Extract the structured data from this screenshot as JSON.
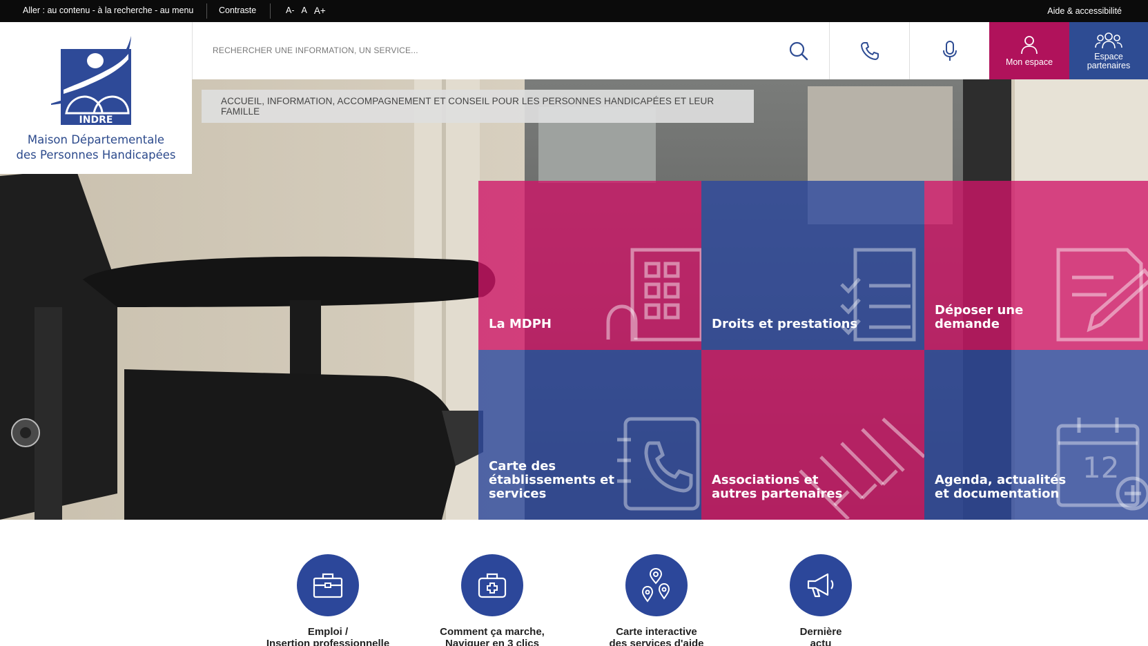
{
  "topbar": {
    "skip_prefix": "Aller : ",
    "skip_content": "au contenu",
    "skip_sep1": " - ",
    "skip_search": "à la recherche",
    "skip_sep2": " - ",
    "skip_menu": "au menu",
    "contrast": "Contraste",
    "font_smaller": "A-",
    "font_normal": "A",
    "font_larger": "A+",
    "help": "Aide & accessibilité"
  },
  "logo": {
    "badge_text": "INDRE",
    "line1": "Maison Départementale",
    "line2": "des Personnes Handicapées"
  },
  "search": {
    "placeholder": "RECHERCHER UNE INFORMATION, UN SERVICE..."
  },
  "header_buttons": {
    "espace": "Mon espace",
    "partners_line1": "Espace",
    "partners_line2": "partenaires"
  },
  "hero": {
    "tagline": "ACCUEIL, INFORMATION, ACCOMPAGNEMENT ET CONSEIL POUR LES PERSONNES HANDICAPÉES ET LEUR FAMILLE"
  },
  "tiles": [
    {
      "label": "La MDPH",
      "icon": "building-icon"
    },
    {
      "label": "Droits et prestations",
      "icon": "checklist-icon"
    },
    {
      "label": "Déposer une demande",
      "icon": "document-pen-icon"
    },
    {
      "label": "Carte des établissements et services",
      "icon": "phone-book-icon"
    },
    {
      "label": "Associations et autres partenaires",
      "icon": "handshake-icon"
    },
    {
      "label": "Agenda, actualités et documentation",
      "icon": "calendar-icon"
    }
  ],
  "quicklinks": [
    {
      "line1": "Emploi /",
      "line2": "Insertion professionnelle",
      "icon": "briefcase-icon"
    },
    {
      "line1": "Comment ça marche,",
      "line2": "Naviguer en 3 clics",
      "icon": "first-aid-kit-icon"
    },
    {
      "line1": "Carte interactive",
      "line2": "des services d'aide",
      "icon": "map-pins-icon"
    },
    {
      "line1": "Dernière",
      "line2": "actu",
      "icon": "megaphone-icon"
    }
  ],
  "colors": {
    "pink": "#b0125b",
    "blue": "#2e4c93",
    "topbar": "#0b0b0b"
  }
}
